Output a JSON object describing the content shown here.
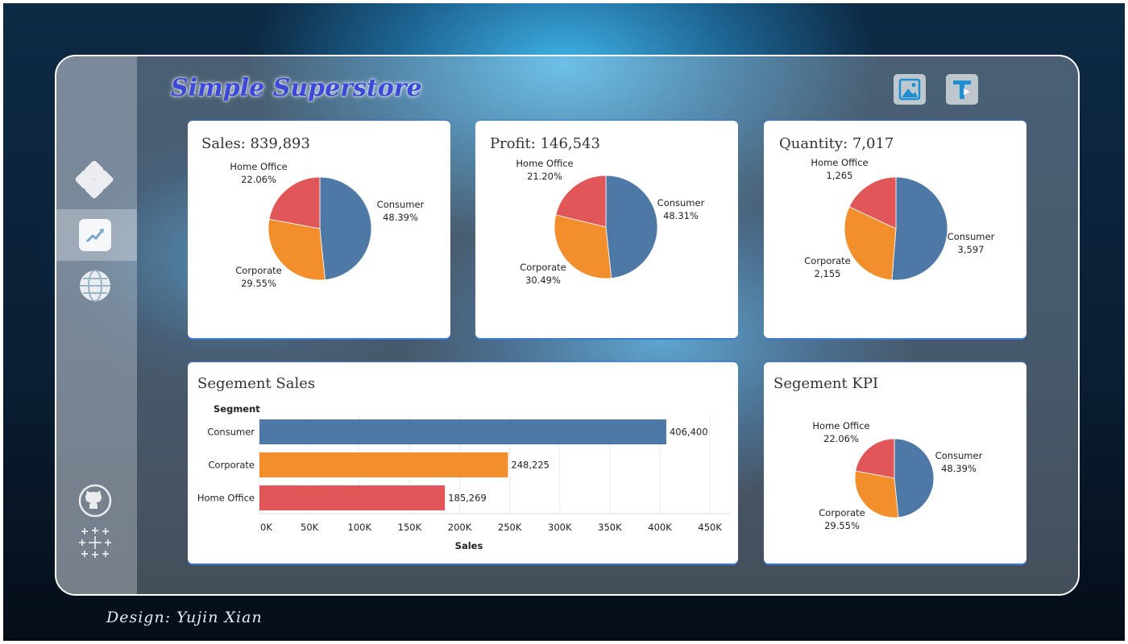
{
  "app": {
    "title": "Simple Superstore",
    "footer": "Design: Yujin Xian"
  },
  "colors": {
    "consumer": "#4e79a7",
    "corporate": "#f28e2b",
    "home_office": "#e15759",
    "accent": "#3a78d8"
  },
  "sidebar": {
    "items": [
      {
        "icon": "tableau-logo-icon",
        "active": false
      },
      {
        "icon": "trend-chart-icon",
        "active": true
      },
      {
        "icon": "globe-icon",
        "active": false
      }
    ],
    "bottom": [
      {
        "icon": "github-icon"
      },
      {
        "icon": "tableau-sparkle-icon"
      }
    ]
  },
  "toolbar": {
    "buttons": [
      {
        "icon": "image-icon"
      },
      {
        "icon": "filter-icon"
      }
    ]
  },
  "cards": [
    {
      "title": "Sales: 839,893",
      "chart_key": 0
    },
    {
      "title": "Profit: 146,543",
      "chart_key": 1
    },
    {
      "title": "Quantity: 7,017",
      "chart_key": 2
    },
    {
      "title": "Segement Sales",
      "chart_key": 3
    },
    {
      "title": "Segement KPI",
      "chart_key": 4
    }
  ],
  "chart_data": [
    {
      "type": "pie",
      "title": "Sales: 839,893",
      "slices": [
        {
          "label": "Consumer",
          "value": 48.39,
          "display": "48.39%"
        },
        {
          "label": "Corporate",
          "value": 29.55,
          "display": "29.55%"
        },
        {
          "label": "Home Office",
          "value": 22.06,
          "display": "22.06%"
        }
      ]
    },
    {
      "type": "pie",
      "title": "Profit: 146,543",
      "slices": [
        {
          "label": "Consumer",
          "value": 48.31,
          "display": "48.31%"
        },
        {
          "label": "Corporate",
          "value": 30.49,
          "display": "30.49%"
        },
        {
          "label": "Home Office",
          "value": 21.2,
          "display": "21.20%"
        }
      ]
    },
    {
      "type": "pie",
      "title": "Quantity: 7,017",
      "slices": [
        {
          "label": "Consumer",
          "value": 3597,
          "display": "3,597"
        },
        {
          "label": "Corporate",
          "value": 2155,
          "display": "2,155"
        },
        {
          "label": "Home Office",
          "value": 1265,
          "display": "1,265"
        }
      ]
    },
    {
      "type": "bar",
      "orientation": "horizontal",
      "title": "Segement Sales",
      "row_header": "Segment",
      "xlabel": "Sales",
      "categories": [
        "Consumer",
        "Corporate",
        "Home Office"
      ],
      "values": [
        406400,
        248225,
        185269
      ],
      "value_labels": [
        "406,400",
        "248,225",
        "185,269"
      ],
      "xlim": [
        0,
        470000
      ],
      "ticks": [
        0,
        50000,
        100000,
        150000,
        200000,
        250000,
        300000,
        350000,
        400000,
        450000
      ],
      "tick_labels": [
        "0K",
        "50K",
        "100K",
        "150K",
        "200K",
        "250K",
        "300K",
        "350K",
        "400K",
        "450K"
      ],
      "grid": true
    },
    {
      "type": "pie",
      "title": "Segement KPI",
      "slices": [
        {
          "label": "Consumer",
          "value": 48.39,
          "display": "48.39%"
        },
        {
          "label": "Corporate",
          "value": 29.55,
          "display": "29.55%"
        },
        {
          "label": "Home Office",
          "value": 22.06,
          "display": "22.06%"
        }
      ]
    }
  ]
}
